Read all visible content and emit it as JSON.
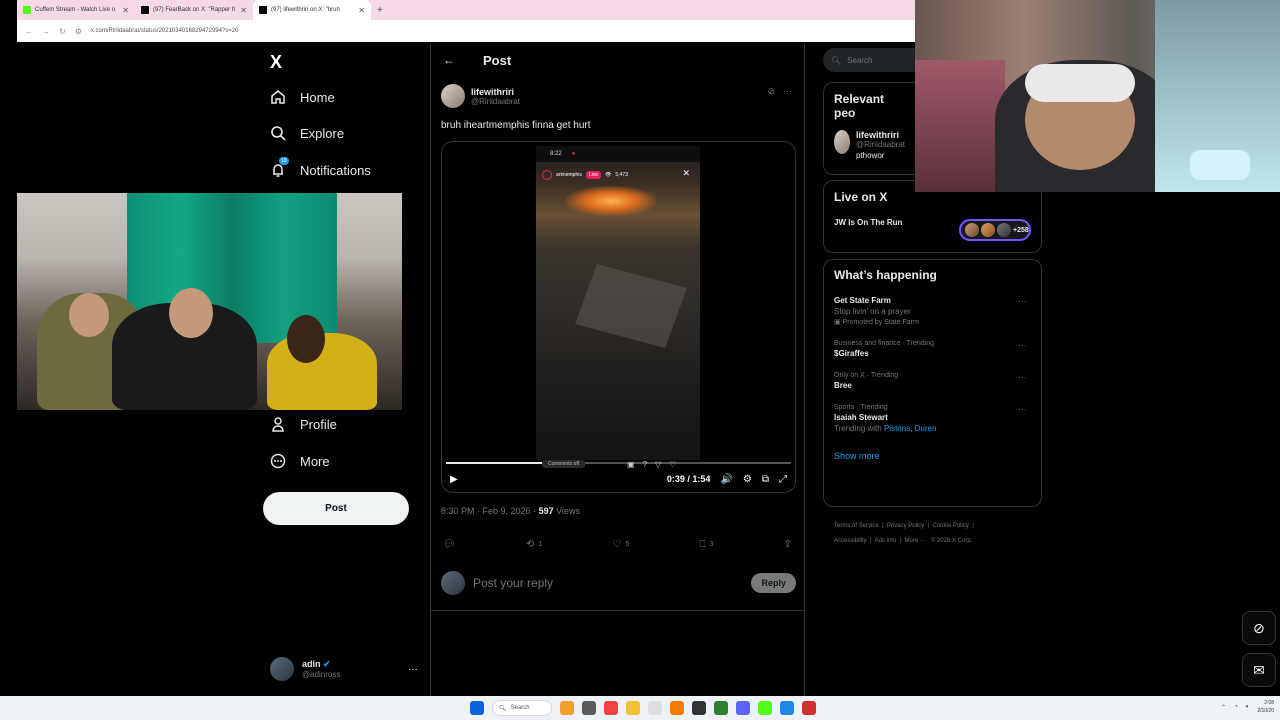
{
  "browser": {
    "tabs": [
      {
        "title": "Cuffem Stream - Watch Live o",
        "color": "#53fc18"
      },
      {
        "title": "(97) FearBack on X: \"Rapper fr",
        "color": "#000000"
      },
      {
        "title": "(97) lifewithriri on X: \"bruh",
        "color": "#000000"
      }
    ],
    "new_tab": "+",
    "url": "x.com/Ririidaabrat/status/2021034016829472994?s=20"
  },
  "nav": {
    "logo": "X",
    "home": "Home",
    "explore": "Explore",
    "notifications": "Notifications",
    "notifications_badge": "18",
    "profile": "Profile",
    "more": "More",
    "post": "Post"
  },
  "account": {
    "name": "adin",
    "handle": "@adinross",
    "menu": "···"
  },
  "post_header": {
    "back": "←",
    "title": "Post"
  },
  "post": {
    "author_name": "lifewithriri",
    "author_handle": "@Ririidaabrat",
    "text": "bruh iheartmemphis finna get hurt",
    "more": "···",
    "timestamp": "8:30 PM · Feb 9, 2026 · ",
    "views_count": "597",
    "views_label": " Views",
    "retweets": "1",
    "likes": "5",
    "bookmarks": "3"
  },
  "video": {
    "phone_time": "8:22",
    "streamer": "arimemphis",
    "live_label": "Live",
    "viewers": "5,473",
    "comments": "Comments off",
    "time": "0:39 / 1:54",
    "progress": 0.34
  },
  "reply": {
    "placeholder": "Post your reply",
    "button": "Reply"
  },
  "search": {
    "placeholder": "Search"
  },
  "relevant": {
    "title": "Relevant peo",
    "name": "lifewithriri",
    "handle": "@Ririidaabrat",
    "bio": "pthowor"
  },
  "live_on_x": {
    "title": "Live on X",
    "stream_name": "JW Is On The Run",
    "count": "+258"
  },
  "happening": {
    "title": "What’s happening",
    "trends": [
      {
        "category": "",
        "name": "Get State Farm",
        "sub": "Stop livin’ on a prayer",
        "promo": "Promoted by State Farm"
      },
      {
        "category": "Business and finance · Trending",
        "name": "$Giraffes",
        "sub": "",
        "promo": ""
      },
      {
        "category": "Only on X · Trending",
        "name": "Bree",
        "sub": "",
        "promo": ""
      },
      {
        "category": "Sports · Trending",
        "name": "Isaiah Stewart",
        "sub": "Trending with",
        "promo": "Pistons, Duren"
      }
    ],
    "show_more": "Show more"
  },
  "footer": {
    "terms": "Terms of Service",
    "privacy": "Privacy Policy",
    "cookie": "Cookie Policy",
    "accessibility": "Accessibility",
    "ads": "Ads info",
    "more": "More ···",
    "copyright": "© 2026 X Corp."
  },
  "taskbar": {
    "search": "Search",
    "time": "2:08",
    "date": "2/10/20"
  }
}
